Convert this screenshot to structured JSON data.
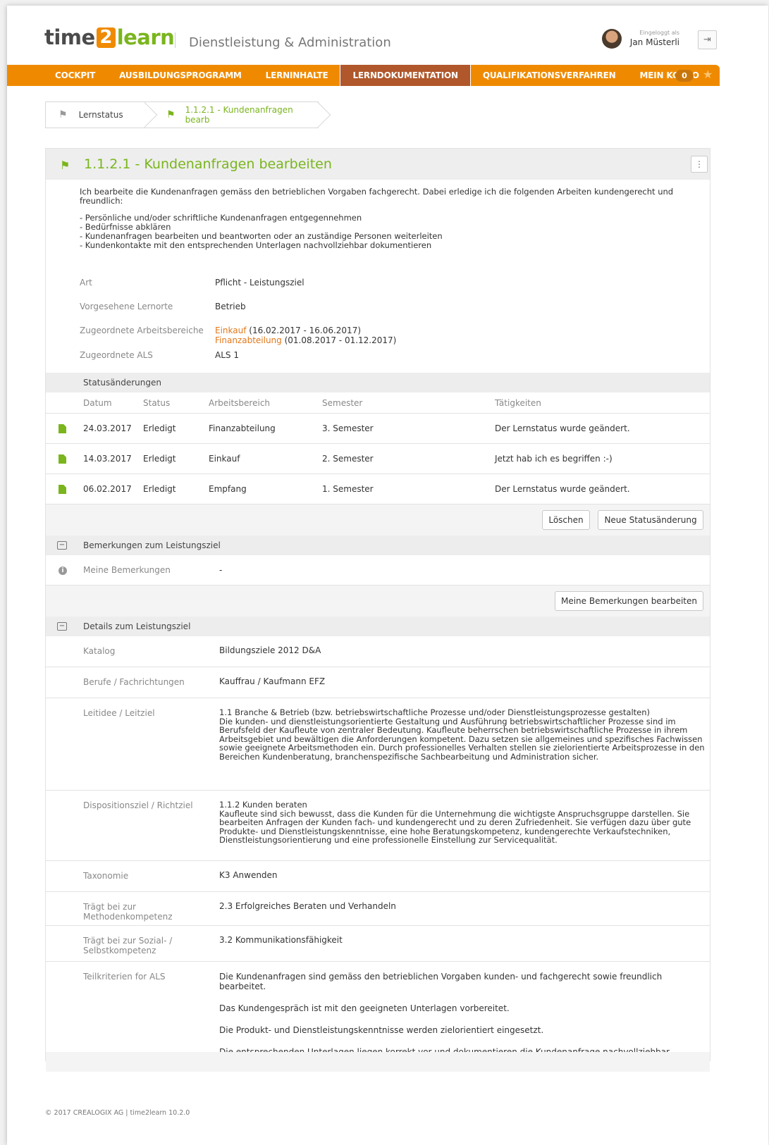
{
  "header": {
    "logo_time": "time",
    "logo_two": "2",
    "logo_learn": "learn",
    "app_title": "Dienstleistung & Administration",
    "login_label": "Eingeloggt als",
    "user_name": "Jan Müsterli",
    "logout_icon": "⇥"
  },
  "nav": {
    "items": [
      "COCKPIT",
      "AUSBILDUNGSPROGRAMM",
      "LERNINHALTE",
      "LERNDOKUMENTATION",
      "QUALIFIKATIONSVERFAHREN",
      "MEIN KONTO"
    ],
    "active_index": 3,
    "badge": "0",
    "accent_color": "#ef8a00",
    "active_color": "#b0572b"
  },
  "breadcrumb": {
    "item1": "Lernstatus",
    "item2": "1.1.2.1 - Kundenanfragen bearb"
  },
  "panel": {
    "title": "1.1.2.1 - Kundenanfragen bearbeiten",
    "title_color": "#7ab51d",
    "intro": "Ich bearbeite die Kundenanfragen gemäss den betrieblichen Vorgaben fachgerecht. Dabei erledige ich die folgenden Arbeiten kundengerecht und freundlich:",
    "bullets": [
      "- Persönliche und/oder schriftliche Kundenanfragen entgegennehmen",
      "- Bedürfnisse abklären",
      "- Kundenanfragen bearbeiten und beantworten oder an zuständige Personen weiterleiten",
      "- Kundenkontakte mit den entsprechenden Unterlagen nachvollziehbar dokumentieren"
    ],
    "fields": {
      "art_label": "Art",
      "art_value": "Pflicht - Leistungsziel",
      "lernorte_label": "Vorgesehene Lernorte",
      "lernorte_value": "Betrieb",
      "bereiche_label": "Zugeordnete Arbeitsbereiche",
      "bereich1_link": "Einkauf",
      "bereich1_dates": " (16.02.2017 - 16.06.2017)",
      "bereich2_link": "Finanzabteilung",
      "bereich2_dates": " (01.08.2017 - 01.12.2017)",
      "als_label": "Zugeordnete ALS",
      "als_value": "ALS 1"
    }
  },
  "status": {
    "section_title": "Statusänderungen",
    "columns": [
      "Datum",
      "Status",
      "Arbeitsbereich",
      "Semester",
      "Tätigkeiten"
    ],
    "rows": [
      {
        "datum": "24.03.2017",
        "status": "Erledigt",
        "bereich": "Finanzabteilung",
        "semester": "3. Semester",
        "taetigkeit": "Der Lernstatus wurde geändert."
      },
      {
        "datum": "14.03.2017",
        "status": "Erledigt",
        "bereich": "Einkauf",
        "semester": "2. Semester",
        "taetigkeit": "Jetzt hab ich es begriffen :-)"
      },
      {
        "datum": "06.02.2017",
        "status": "Erledigt",
        "bereich": "Empfang",
        "semester": "1. Semester",
        "taetigkeit": "Der Lernstatus wurde geändert."
      }
    ],
    "delete_label": "Löschen",
    "new_label": "Neue Statusänderung"
  },
  "remarks": {
    "toggle": "−",
    "section_title": "Bemerkungen zum Leistungsziel",
    "label": "Meine Bemerkungen",
    "value": "-",
    "edit_label": "Meine Bemerkungen bearbeiten"
  },
  "details": {
    "toggle": "−",
    "section_title": "Details zum Leistungsziel",
    "katalog_label": "Katalog",
    "katalog_value": "Bildungsziele 2012 D&A",
    "berufe_label": "Berufe / Fachrichtungen",
    "berufe_value": "Kauffrau / Kaufmann EFZ",
    "leitidee_label": "Leitidee / Leitziel",
    "leitidee_title": "1.1 Branche & Betrieb (bzw. betriebswirtschaftliche Prozesse und/oder Dienstleistungsprozesse gestalten)",
    "leitidee_text": "Die kunden- und dienstleistungsorientierte Gestaltung und Ausführung betriebswirtschaftlicher Prozesse sind im Berufsfeld der Kaufleute von zentraler Bedeutung. Kaufleute beherrschen betriebswirtschaftliche Prozesse in ihrem Arbeitsgebiet und bewältigen die Anforderungen kompetent. Dazu setzen sie allgemeines und spezifisches Fachwissen sowie geeignete Arbeitsmethoden ein. Durch professionelles Verhalten stellen sie zielorientierte Arbeitsprozesse in den Bereichen Kundenberatung, branchenspezifische Sachbearbeitung und Administration sicher.",
    "disp_label": "Dispositionsziel / Richtziel",
    "disp_title": "1.1.2 Kunden beraten",
    "disp_text": "Kaufleute sind sich bewusst, dass die Kunden für die Unternehmung die wichtigste Anspruchsgruppe darstellen. Sie bearbeiten Anfragen der Kunden fach- und kundengerecht und zu deren Zufriedenheit. Sie verfügen dazu über gute Produkte- und Dienstleistungskenntnisse, eine hohe Beratungskompetenz, kundengerechte Verkaufstechniken, Dienstleistungsorientierung und eine professionelle Einstellung zur Servicequalität.",
    "tax_label": "Taxonomie",
    "tax_value": "K3 Anwenden",
    "methoden_label": "Trägt bei zur Methodenkompetenz",
    "methoden_value": "2.3 Erfolgreiches Beraten und Verhandeln",
    "sozial_label": "Trägt bei zur Sozial- / Selbstkompetenz",
    "sozial_value": "3.2 Kommunikationsfähigkeit",
    "teil_label": "Teilkriterien for ALS",
    "teil_items": [
      "Die Kundenanfragen sind gemäss den betrieblichen Vorgaben kunden- und fachgerecht sowie freundlich bearbeitet.",
      "Das Kundengespräch ist mit den geeigneten Unterlagen vorbereitet.",
      "Die Produkt- und Dienstleistungskenntnisse werden zielorientiert eingesetzt.",
      "Die entsprechenden Unterlagen liegen korrekt vor und dokumentieren die Kundenanfrage nachvollziehbar."
    ]
  },
  "footer": {
    "copyright": "© 2017 CREALOGIX AG | time2learn 10.2.0"
  }
}
